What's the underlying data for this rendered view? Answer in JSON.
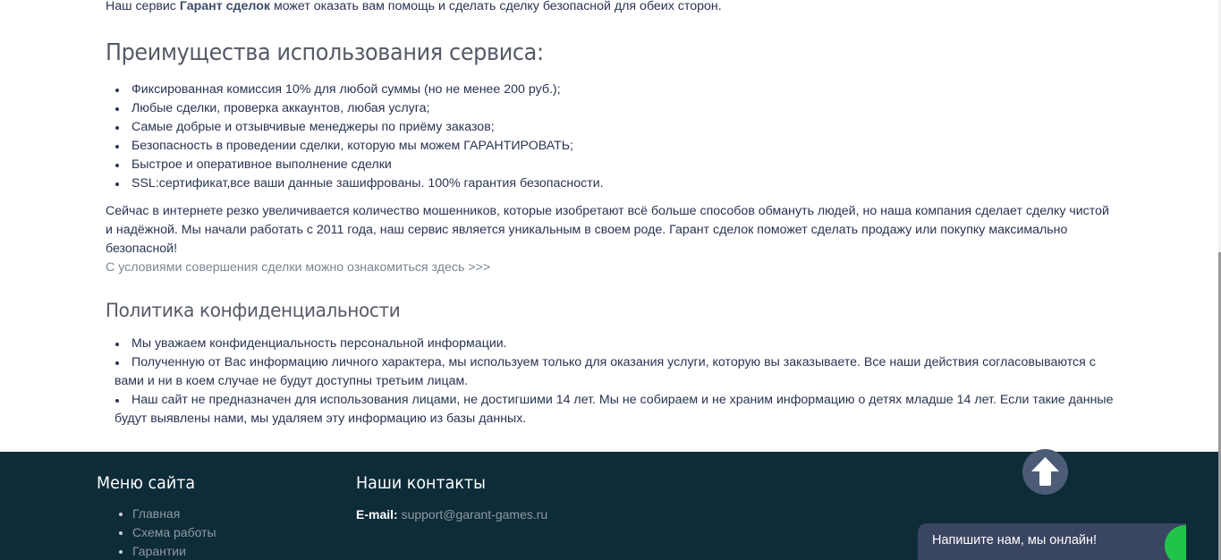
{
  "intro": {
    "before": "Наш сервис ",
    "service_name": "Гарант сделок",
    "after": "  может оказать вам помощь и сделать сделку  безопасной для обеих сторон."
  },
  "advantages": {
    "title": "Преимущества использования сервиса:",
    "items": [
      "Фиксированная комиссия 10% для любой суммы (но не менее 200 руб.);",
      "Любые сделки, проверка аккаунтов, любая услуга;",
      "Самые добрые и отзывчивые менеджеры по приёму заказов;",
      "Безопасность в проведении сделки, которую мы можем ГАРАНТИРОВАТЬ;",
      "Быстрое и оперативное выполнение сделки",
      "SSL:сертификат,все ваши данные зашифрованы. 100% гарантия безопасности."
    ]
  },
  "paragraph": "Сейчас в интернете резко увеличивается количество мошенников, которые изобретают всё больше способов обмануть людей, но наша компания сделает сделку чистой и надёжной. Мы начали работать с 2011 года, наш сервис является уникальным в своем роде. Гарант сделок поможет сделать продажу или покупку максимально безопасной!",
  "terms_link": "С условиями совершения сделки можно ознакомиться здесь >>>",
  "privacy": {
    "title": "Политика конфиденциальности",
    "items": [
      "Мы уважаем конфиденциальность персональной информации.",
      "Полученную от Вас информацию личного характера, мы используем только для оказания услуги, которую вы заказываете. Все наши действия согласовываются с вами и ни в коем случае не будут доступны третьим лицам.",
      "Наш сайт не предназначен для использования лицами, не достигшими 14 лет. Мы не собираем и не храним информацию о детях младше 14 лет. Если такие данные будут выявлены нами, мы удаляем эту информацию из базы данных."
    ]
  },
  "footer": {
    "menu_title": "Меню сайта",
    "menu_items": [
      "Главная",
      "Схема работы",
      "Гарантии"
    ],
    "contacts_title": "Наши контакты",
    "email_label": "E-mail:",
    "email_value": "support@garant-games.ru"
  },
  "scroll_top_icon": "arrow-up-icon",
  "chat": {
    "text": "Напишите нам, мы онлайн!"
  },
  "colors": {
    "footer_bg": "#0e2b38",
    "text": "#2a3352",
    "heading": "#555a66",
    "link": "#7a8592",
    "chat_bg": "#3a4561",
    "online": "#22c34a"
  }
}
